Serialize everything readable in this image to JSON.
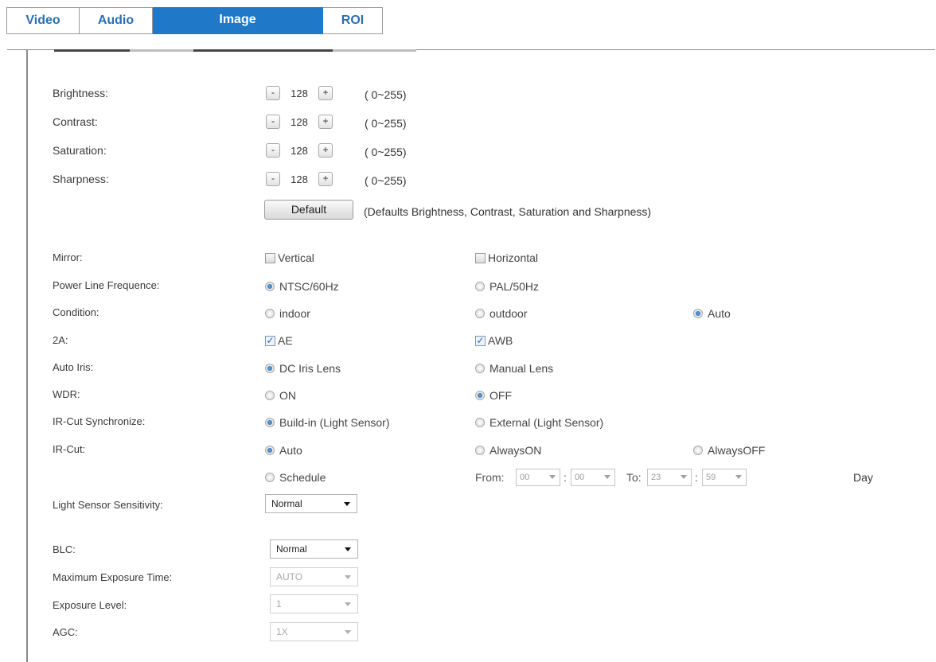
{
  "tabs": [
    "Video",
    "Audio",
    "Image",
    "ROI"
  ],
  "adjustments": [
    {
      "label": "Brightness:",
      "value": "128",
      "range": "( 0~255)"
    },
    {
      "label": "Contrast:",
      "value": "128",
      "range": "( 0~255)"
    },
    {
      "label": "Saturation:",
      "value": "128",
      "range": "( 0~255)"
    },
    {
      "label": "Sharpness:",
      "value": "128",
      "range": "( 0~255)"
    }
  ],
  "stepper": {
    "minus": "-",
    "plus": "+"
  },
  "default_button": "Default",
  "default_note": "(Defaults Brightness, Contrast, Saturation and Sharpness)",
  "mirror": {
    "label": "Mirror:",
    "vertical": "Vertical",
    "horizontal": "Horizontal",
    "vertical_checked": false,
    "horizontal_checked": false
  },
  "power_line": {
    "label": "Power Line Frequence:",
    "options": [
      "NTSC/60Hz",
      "PAL/50Hz"
    ],
    "selected": "NTSC/60Hz"
  },
  "condition": {
    "label": "Condition:",
    "options": [
      "indoor",
      "outdoor",
      "Auto"
    ],
    "selected": "Auto"
  },
  "two_a": {
    "label": "2A:",
    "ae": "AE",
    "awb": "AWB",
    "ae_checked": true,
    "awb_checked": true
  },
  "auto_iris": {
    "label": "Auto Iris:",
    "options": [
      "DC Iris Lens",
      "Manual Lens"
    ],
    "selected": "DC Iris Lens"
  },
  "wdr": {
    "label": "WDR:",
    "options": [
      "ON",
      "OFF"
    ],
    "selected": "OFF"
  },
  "ir_sync": {
    "label": "IR-Cut Synchronize:",
    "options": [
      "Build-in (Light Sensor)",
      "External (Light Sensor)"
    ],
    "selected": "Build-in (Light Sensor)"
  },
  "ir_cut": {
    "label": "IR-Cut:",
    "options": [
      "Auto",
      "AlwaysON",
      "AlwaysOFF",
      "Schedule"
    ],
    "selected": "Auto",
    "from_label": "From:",
    "to_label": "To:",
    "from_hour": "00",
    "from_min": "00",
    "to_hour": "23",
    "to_min": "59",
    "colon": ":",
    "day": "Day"
  },
  "light_sensor": {
    "label": "Light Sensor Sensitivity:",
    "value": "Normal"
  },
  "blc": {
    "label": "BLC:",
    "value": "Normal"
  },
  "max_exposure": {
    "label": "Maximum Exposure Time:",
    "value": "AUTO"
  },
  "exposure_level": {
    "label": "Exposure Level:",
    "value": "1"
  },
  "agc": {
    "label": "AGC:",
    "value": "1X"
  }
}
